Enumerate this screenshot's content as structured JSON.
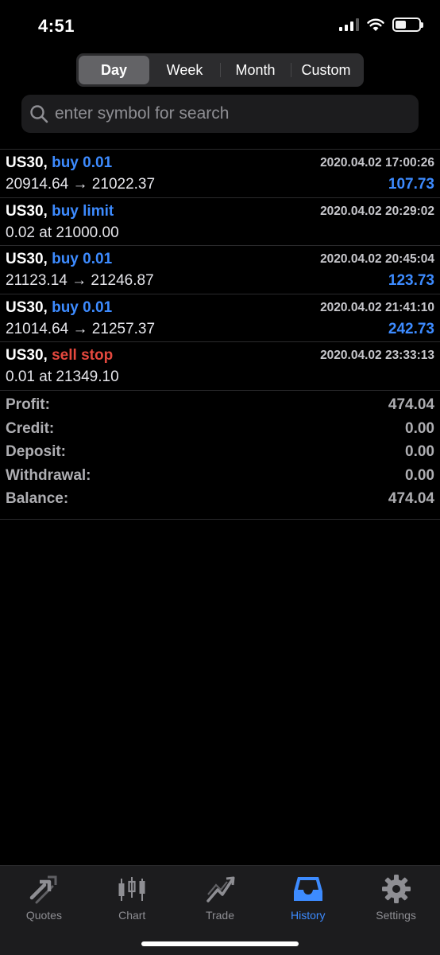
{
  "status_bar": {
    "time": "4:51"
  },
  "period_tabs": [
    {
      "label": "Day",
      "selected": true
    },
    {
      "label": "Week",
      "selected": false
    },
    {
      "label": "Month",
      "selected": false
    },
    {
      "label": "Custom",
      "selected": false
    }
  ],
  "search": {
    "placeholder": "enter symbol for search"
  },
  "orders": [
    {
      "symbol": "US30,",
      "type": "buy 0.01",
      "side": "buy",
      "time": "2020.04.02 17:00:26",
      "detail": "20914.64 → 21022.37",
      "profit": "107.73"
    },
    {
      "symbol": "US30,",
      "type": "buy limit",
      "side": "buy",
      "time": "2020.04.02 20:29:02",
      "detail": "0.02 at 21000.00",
      "profit": ""
    },
    {
      "symbol": "US30,",
      "type": "buy 0.01",
      "side": "buy",
      "time": "2020.04.02 20:45:04",
      "detail": "21123.14 → 21246.87",
      "profit": "123.73"
    },
    {
      "symbol": "US30,",
      "type": "buy 0.01",
      "side": "buy",
      "time": "2020.04.02 21:41:10",
      "detail": "21014.64 → 21257.37",
      "profit": "242.73"
    },
    {
      "symbol": "US30,",
      "type": "sell stop",
      "side": "sell",
      "time": "2020.04.02 23:33:13",
      "detail": "0.01 at 21349.10",
      "profit": ""
    }
  ],
  "summary": [
    {
      "label": "Profit:",
      "value": "474.04"
    },
    {
      "label": "Credit:",
      "value": "0.00"
    },
    {
      "label": "Deposit:",
      "value": "0.00"
    },
    {
      "label": "Withdrawal:",
      "value": "0.00"
    },
    {
      "label": "Balance:",
      "value": "474.04"
    }
  ],
  "tabbar": [
    {
      "label": "Quotes",
      "icon": "quotes-arrows-icon",
      "active": false
    },
    {
      "label": "Chart",
      "icon": "candlestick-icon",
      "active": false
    },
    {
      "label": "Trade",
      "icon": "trade-trend-icon",
      "active": false
    },
    {
      "label": "History",
      "icon": "inbox-tray-icon",
      "active": true
    },
    {
      "label": "Settings",
      "icon": "gear-icon",
      "active": false
    }
  ],
  "colors": {
    "accent": "#3d8bff",
    "sell": "#e5483e",
    "background": "#000000",
    "muted": "#8e8e93"
  }
}
